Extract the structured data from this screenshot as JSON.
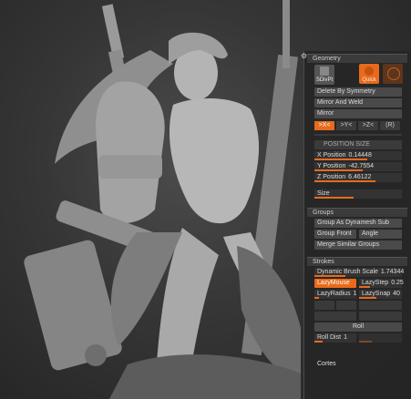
{
  "viewport": {
    "description_icon": "sculpt-model"
  },
  "panel": {
    "corner_icon": "gear-icon",
    "geometry": {
      "title": "Geometry",
      "sdiv_label": "SDivPt",
      "quick_label": "Quick",
      "delete_by_symmetry": "Delete By Symmetry",
      "mirror_and_weld": "Mirror And Weld",
      "mirror": "Mirror",
      "axis_x": ">X<",
      "axis_y": ">Y<",
      "axis_z": ">Z<",
      "axis_r": "(R)",
      "position_size": "POSITION SIZE",
      "x_position_label": "X Position",
      "x_position_value": "0.14448",
      "y_position_label": "Y Position",
      "y_position_value": "-42.7554",
      "z_position_label": "Z Position",
      "z_position_value": "6.46122",
      "size_label": "Size"
    },
    "groups": {
      "title": "Groups",
      "group_as_dynamesh_sub": "Group As Dynamesh Sub",
      "group_front": "Group Front",
      "angle": "Angle",
      "merge_similar_groups": "Merge Similar Groups"
    },
    "strokes": {
      "title": "Strokes",
      "dynamic_brush_scale_label": "Dynamic Brush Scale",
      "dynamic_brush_scale_value": "1.74344",
      "lazymouse": "LazyMouse",
      "lazystep_label": "LazyStep",
      "lazystep_value": "0.25",
      "lazyradius_label": "LazyRadius",
      "lazyradius_value": "1",
      "lazysnap_label": "LazySnap",
      "lazysnap_value": "40",
      "roll": "Roll",
      "roll_dist_label": "Roll Dist",
      "roll_dist_value": "1"
    },
    "cortes": "Cortes"
  },
  "colors": {
    "accent": "#e86a1a",
    "panel_bg": "#262626",
    "button_bg": "#4a4a4a"
  }
}
